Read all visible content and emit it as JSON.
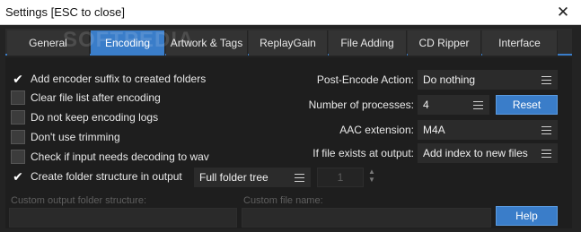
{
  "window": {
    "title": "Settings [ESC to close]",
    "close_glyph": "✕"
  },
  "watermark": "SOFTPEDIA",
  "tabs": [
    {
      "label": "General",
      "active": false
    },
    {
      "label": "Encoding",
      "active": true
    },
    {
      "label": "Artwork & Tags",
      "active": false
    },
    {
      "label": "ReplayGain",
      "active": false
    },
    {
      "label": "File Adding",
      "active": false
    },
    {
      "label": "CD Ripper",
      "active": false
    },
    {
      "label": "Interface",
      "active": false
    }
  ],
  "options": [
    {
      "label": "Add encoder suffix to created folders",
      "checked": true
    },
    {
      "label": "Clear file list after encoding",
      "checked": false
    },
    {
      "label": "Do not keep encoding logs",
      "checked": false
    },
    {
      "label": "Don't use trimming",
      "checked": false
    },
    {
      "label": "Check if input needs decoding to wav",
      "checked": false
    },
    {
      "label": "Create folder structure in output",
      "checked": true
    }
  ],
  "check_glyph": "✔",
  "folder_structure": {
    "value": "Full folder tree"
  },
  "folder_depth": {
    "value": "1"
  },
  "right": {
    "post_encode": {
      "label": "Post-Encode Action:",
      "value": "Do nothing"
    },
    "processes": {
      "label": "Number of processes:",
      "value": "4"
    },
    "aac": {
      "label": "AAC extension:",
      "value": "M4A"
    },
    "exists": {
      "label": "If file exists at output:",
      "value": "Add index to new files"
    }
  },
  "reset_label": "Reset",
  "help_label": "Help",
  "custom_output": {
    "label": "Custom output folder structure:"
  },
  "custom_filename": {
    "label": "Custom file name:"
  },
  "colors": {
    "accent": "#3a7dc9",
    "panel": "#1e1e1e",
    "titlebar": "#ffffff"
  }
}
